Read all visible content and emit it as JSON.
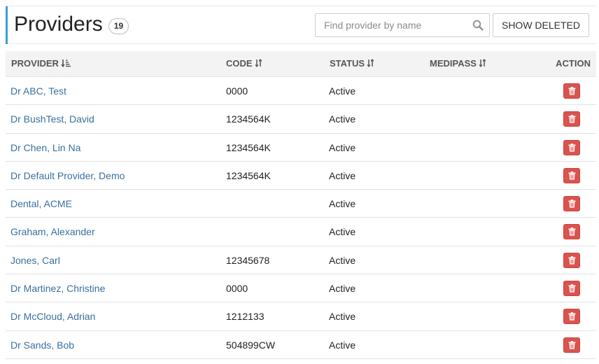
{
  "header": {
    "title": "Providers",
    "count": "19",
    "search_placeholder": "Find provider by name",
    "search_value": "",
    "show_deleted_label": "SHOW DELETED"
  },
  "table": {
    "columns": {
      "provider": "PROVIDER",
      "code": "CODE",
      "status": "STATUS",
      "medipass": "MEDIPASS",
      "action": "ACTION"
    },
    "rows": [
      {
        "provider": "Dr ABC, Test",
        "code": "0000",
        "status": "Active",
        "medipass": ""
      },
      {
        "provider": "Dr BushTest, David",
        "code": "1234564K",
        "status": "Active",
        "medipass": ""
      },
      {
        "provider": "Dr Chen, Lin Na",
        "code": "1234564K",
        "status": "Active",
        "medipass": ""
      },
      {
        "provider": "Dr Default Provider, Demo",
        "code": "1234564K",
        "status": "Active",
        "medipass": ""
      },
      {
        "provider": "Dental, ACME",
        "code": "",
        "status": "Active",
        "medipass": ""
      },
      {
        "provider": "Graham, Alexander",
        "code": "",
        "status": "Active",
        "medipass": ""
      },
      {
        "provider": "Jones, Carl",
        "code": "12345678",
        "status": "Active",
        "medipass": ""
      },
      {
        "provider": "Dr Martinez, Christine",
        "code": "0000",
        "status": "Active",
        "medipass": ""
      },
      {
        "provider": "Dr McCloud, Adrian",
        "code": "1212133",
        "status": "Active",
        "medipass": ""
      },
      {
        "provider": "Dr Sands, Bob",
        "code": "504899CW",
        "status": "Active",
        "medipass": ""
      }
    ]
  },
  "icons": {
    "search": "search-icon",
    "sort_active": "sort-amount-asc-icon",
    "sort": "sort-icon",
    "delete": "trash-icon"
  },
  "colors": {
    "accent": "#3b9fd3",
    "link": "#3a6fa0",
    "danger": "#d9534f",
    "header_bg": "#f3f3f3"
  }
}
